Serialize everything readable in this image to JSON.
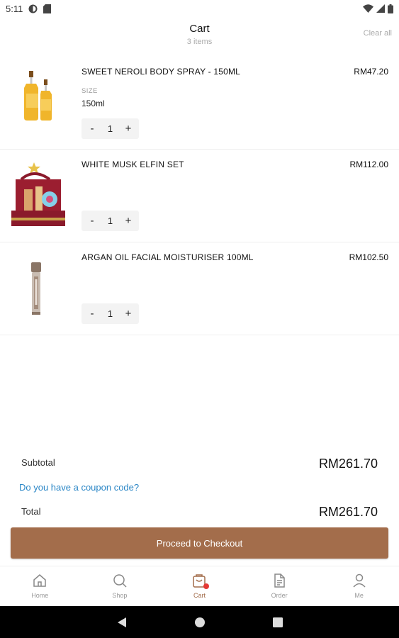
{
  "status_bar": {
    "time": "5:11"
  },
  "header": {
    "title": "Cart",
    "subtitle": "3 items",
    "clear_all": "Clear all"
  },
  "cart": {
    "items": [
      {
        "name": "SWEET NEROLI BODY SPRAY - 150ML",
        "price": "RM47.20",
        "size_label": "SIZE",
        "size_value": "150ml",
        "quantity": "1",
        "image_icon": "spray-bottles-image"
      },
      {
        "name": "WHITE MUSK ELFIN SET",
        "price": "RM112.00",
        "quantity": "1",
        "image_icon": "gift-set-image"
      },
      {
        "name": "ARGAN OIL FACIAL MOISTURISER 100ML",
        "price": "RM102.50",
        "quantity": "1",
        "image_icon": "moisturiser-bottle-image"
      }
    ],
    "minus_label": "-",
    "plus_label": "+"
  },
  "summary": {
    "subtotal_label": "Subtotal",
    "subtotal_value": "RM261.70",
    "coupon_link": "Do you have a coupon code?",
    "total_label": "Total",
    "total_value": "RM261.70"
  },
  "checkout": {
    "label": "Proceed to Checkout"
  },
  "bottom_nav": {
    "items": [
      {
        "label": "Home",
        "icon": "home-icon"
      },
      {
        "label": "Shop",
        "icon": "search-icon"
      },
      {
        "label": "Cart",
        "icon": "cart-icon",
        "active": true
      },
      {
        "label": "Order",
        "icon": "document-icon"
      },
      {
        "label": "Me",
        "icon": "person-icon"
      }
    ]
  },
  "colors": {
    "accent": "#a36d4b",
    "link": "#2a86c6",
    "badge": "#e53935"
  }
}
